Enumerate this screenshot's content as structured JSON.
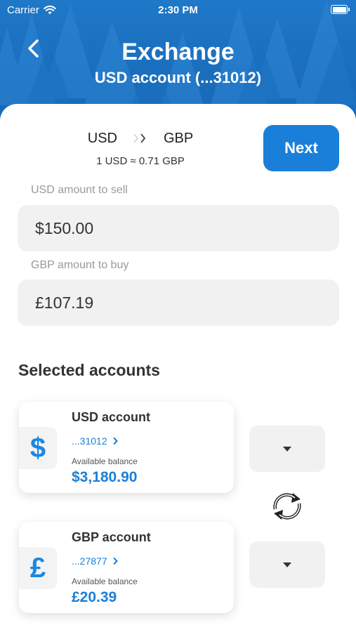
{
  "status_bar": {
    "carrier": "Carrier",
    "time": "2:30 PM"
  },
  "header": {
    "title": "Exchange",
    "subtitle": "USD account (...31012)"
  },
  "exchange": {
    "from_currency": "USD",
    "to_currency": "GBP",
    "rate": "1 USD ≈ 0.71 GBP",
    "next_label": "Next"
  },
  "sell": {
    "label": "USD amount to sell",
    "value": "$150.00"
  },
  "buy": {
    "label": "GBP amount to buy",
    "value": "£107.19"
  },
  "selected_accounts": {
    "title": "Selected accounts",
    "accounts": [
      {
        "symbol": "$",
        "name": "USD account",
        "number": "...31012",
        "balance_label": "Available balance",
        "balance": "$3,180.90"
      },
      {
        "symbol": "£",
        "name": "GBP account",
        "number": "...27877",
        "balance_label": "Available balance",
        "balance": "£20.39"
      }
    ]
  },
  "colors": {
    "brand": "#1a7fd8",
    "header": "#1f78c8",
    "field_bg": "#f1f1f1"
  },
  "icons": [
    "back-chevron-icon",
    "wifi-icon",
    "battery-icon",
    "chevron-right-icon",
    "caret-down-icon",
    "swap-icon",
    "dollar-icon",
    "pound-icon"
  ]
}
